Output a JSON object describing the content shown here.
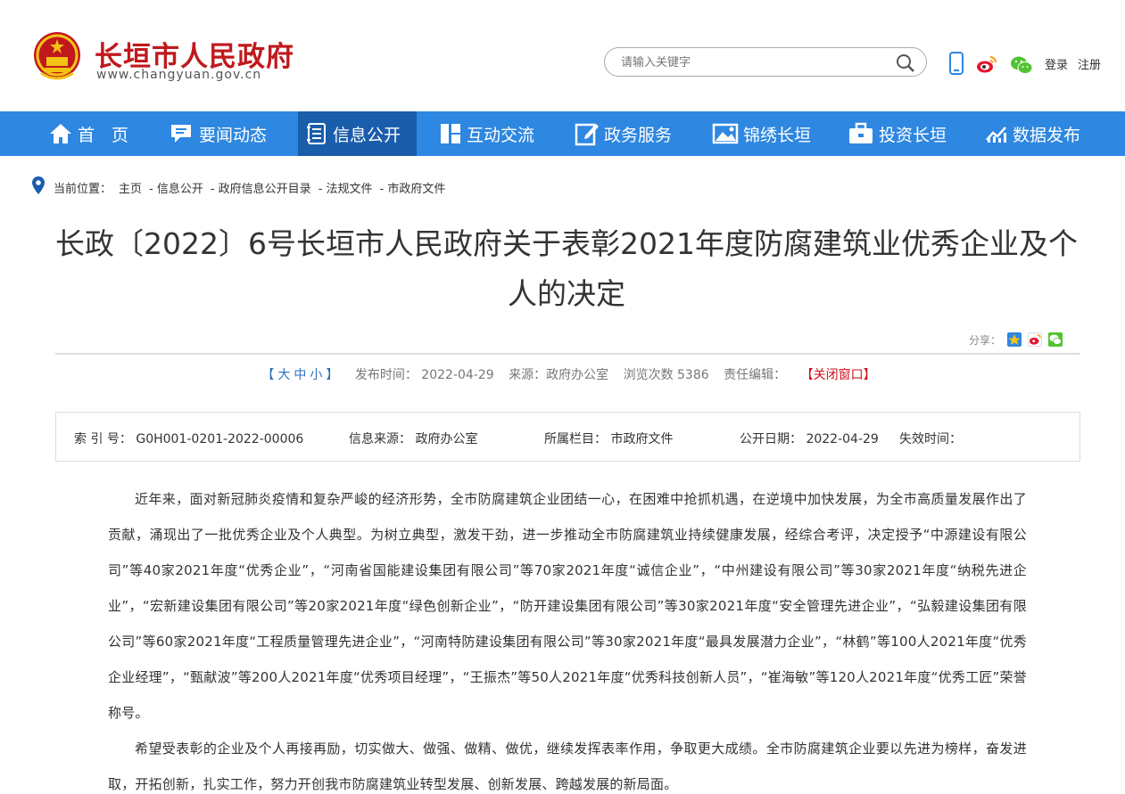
{
  "header": {
    "site_title": "长垣市人民政府",
    "site_url": "www.changyuan.gov.cn",
    "search_placeholder": "请输入关键字",
    "login_label": "登录",
    "register_label": "注册",
    "emblem_color": "#c0191d"
  },
  "nav": {
    "color": "#2e87e0",
    "active_color": "#1a5dab",
    "items": [
      {
        "label": "首　页",
        "icon": "home-icon"
      },
      {
        "label": "要闻动态",
        "icon": "chat-icon"
      },
      {
        "label": "信息公开",
        "icon": "notebook-icon"
      },
      {
        "label": "互动交流",
        "icon": "layout-icon"
      },
      {
        "label": "政务服务",
        "icon": "edit-icon"
      },
      {
        "label": "锦绣长垣",
        "icon": "picture-icon"
      },
      {
        "label": "投资长垣",
        "icon": "briefcase-icon"
      },
      {
        "label": "数据发布",
        "icon": "chart-icon"
      }
    ]
  },
  "breadcrumb": {
    "label": "当前位置：",
    "items": [
      "主页",
      "- 信息公开",
      "- 政府信息公开目录",
      "- 法规文件",
      "- 市政府文件"
    ]
  },
  "article": {
    "title": "长政〔2022〕6号长垣市人民政府关于表彰2021年度防腐建筑业优秀企业及个人的决定",
    "share_label": "分享：",
    "font_size": {
      "open": "【",
      "large": "大",
      "medium": "中",
      "small": "小",
      "close": "】"
    },
    "publish_time": "发布时间： 2022-04-29",
    "source": "来源：政府办公室",
    "views": "浏览次数 5386",
    "editor": "责任编辑：",
    "close_window": "【关闭窗口】"
  },
  "info": {
    "index": "索 引 号： G0H001-0201-2022-00006",
    "info_source": "信息来源： 政府办公室",
    "column": "所属栏目： 市政府文件",
    "public_date": "公开日期： 2022-04-29",
    "expire": "失效时间："
  },
  "content": {
    "p1": "近年来，面对新冠肺炎疫情和复杂严峻的经济形势，全市防腐建筑企业团结一心，在困难中抢抓机遇，在逆境中加快发展，为全市高质量发展作出了贡献，涌现出了一批优秀企业及个人典型。为树立典型，激发干劲，进一步推动全市防腐建筑业持续健康发展，经综合考评，决定授予“中源建设有限公司”等40家2021年度“优秀企业”，“河南省国能建设集团有限公司”等70家2021年度“诚信企业”，“中州建设有限公司”等30家2021年度“纳税先进企业”，“宏新建设集团有限公司”等20家2021年度“绿色创新企业”，“防开建设集团有限公司”等30家2021年度“安全管理先进企业”，“弘毅建设集团有限公司”等60家2021年度“工程质量管理先进企业”，“河南特防建设集团有限公司”等30家2021年度“最具发展潜力企业”，“林鹤”等100人2021年度“优秀企业经理”，“甄献波”等200人2021年度“优秀项目经理”，“王振杰”等50人2021年度“优秀科技创新人员”，“崔海敏”等120人2021年度“优秀工匠”荣誉称号。",
    "p2": "希望受表彰的企业及个人再接再励，切实做大、做强、做精、做优，继续发挥表率作用，争取更大成绩。全市防腐建筑企业要以先进为榜样，奋发进取，开拓创新，扎实工作，努力开创我市防腐建筑业转型发展、创新发展、跨越发展的新局面。"
  }
}
